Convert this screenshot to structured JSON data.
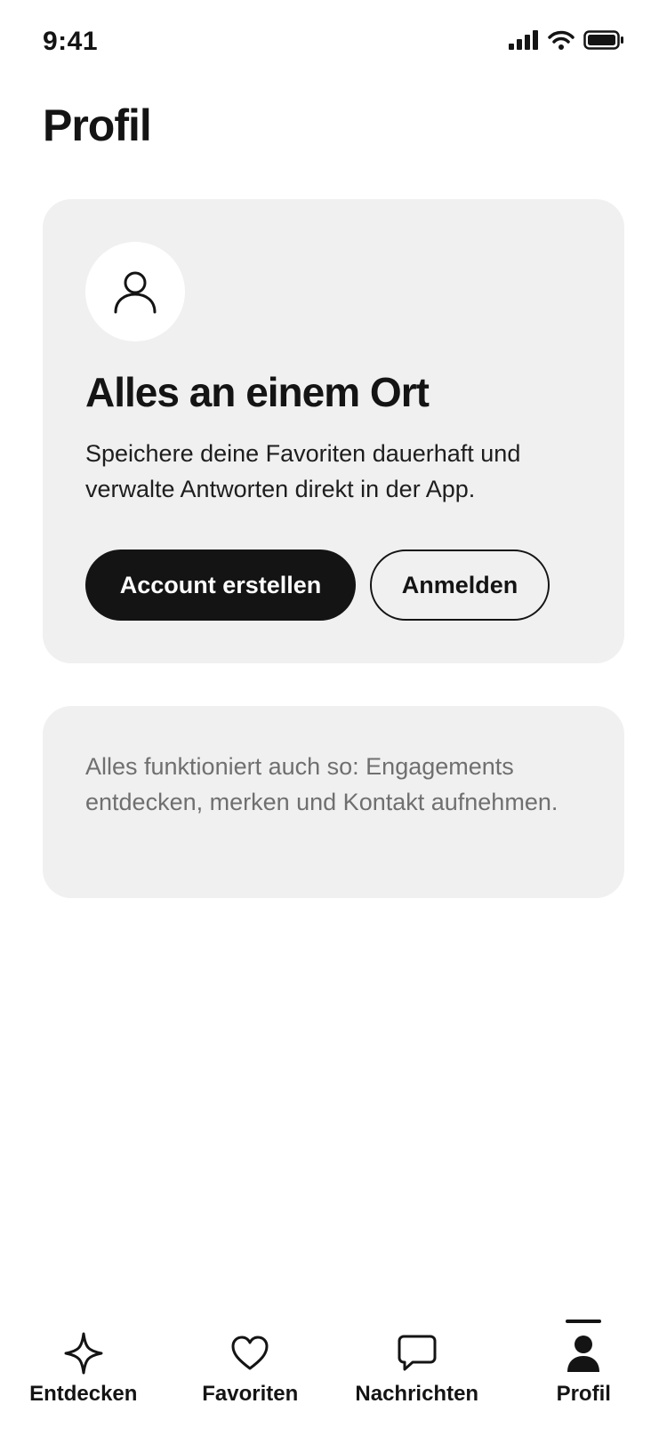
{
  "status_bar": {
    "time": "9:41"
  },
  "header": {
    "title": "Profil"
  },
  "account_card": {
    "heading": "Alles an einem Ort",
    "text": "Speichere deine Favoriten dauerhaft und verwalte Antworten direkt in der App.",
    "primary_button": "Account erstellen",
    "secondary_button": "Anmelden"
  },
  "info_card": {
    "text": "Alles funktioniert auch so: Engagements entdecken, merken und Kontakt aufnehmen."
  },
  "tab_bar": {
    "items": [
      {
        "label": "Entdecken",
        "icon": "sparkle-icon",
        "active": false
      },
      {
        "label": "Favoriten",
        "icon": "heart-icon",
        "active": false
      },
      {
        "label": "Nachrichten",
        "icon": "chat-bubble-icon",
        "active": false
      },
      {
        "label": "Profil",
        "icon": "person-icon",
        "active": true
      }
    ]
  },
  "colors": {
    "text": "#141414",
    "card_background": "#f0f0f0",
    "muted_text": "#6f6f6f",
    "background": "#ffffff"
  }
}
